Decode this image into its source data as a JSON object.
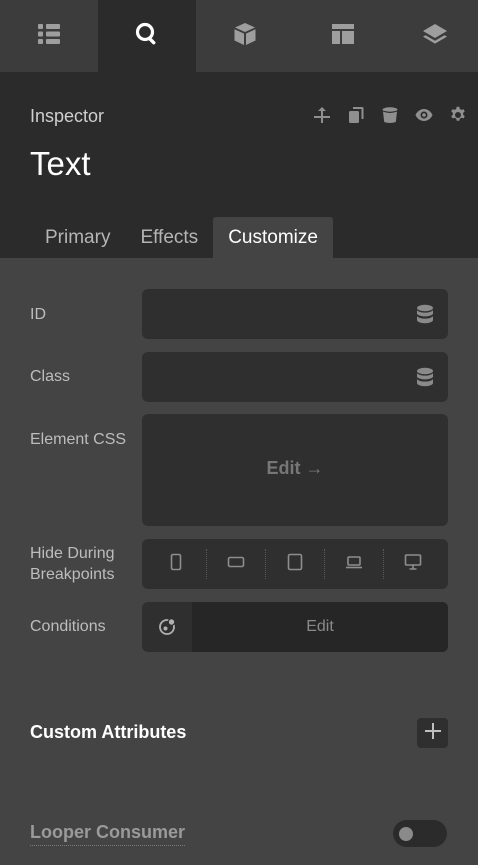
{
  "top_tabs": [
    {
      "icon": "list-icon",
      "active": false
    },
    {
      "icon": "search-icon",
      "active": true
    },
    {
      "icon": "cube-icon",
      "active": false
    },
    {
      "icon": "layout-icon",
      "active": false
    },
    {
      "icon": "layers-icon",
      "active": false
    }
  ],
  "inspector": {
    "label": "Inspector",
    "element_title": "Text",
    "tools": [
      "move-icon",
      "copy-icon",
      "trash-icon",
      "eye-icon",
      "gear-icon"
    ]
  },
  "subtabs": [
    {
      "label": "Primary",
      "active": false
    },
    {
      "label": "Effects",
      "active": false
    },
    {
      "label": "Customize",
      "active": true
    }
  ],
  "fields": {
    "id_label": "ID",
    "id_value": "",
    "class_label": "Class",
    "class_value": "",
    "element_css_label": "Element CSS",
    "element_css_edit": "Edit →",
    "hide_breakpoints_label_line1": "Hide During",
    "hide_breakpoints_label_line2": "Breakpoints",
    "breakpoints": [
      "phone-portrait-icon",
      "phone-landscape-icon",
      "tablet-icon",
      "laptop-icon",
      "desktop-icon"
    ],
    "conditions_label": "Conditions",
    "conditions_edit": "Edit"
  },
  "custom_attributes": {
    "title": "Custom Attributes"
  },
  "looper": {
    "title": "Looper Consumer",
    "enabled": false
  },
  "colors": {
    "panel_bg": "#444444",
    "header_bg": "#2b2b2b",
    "field_bg": "#2f2f2f",
    "text_primary": "#ffffff"
  }
}
